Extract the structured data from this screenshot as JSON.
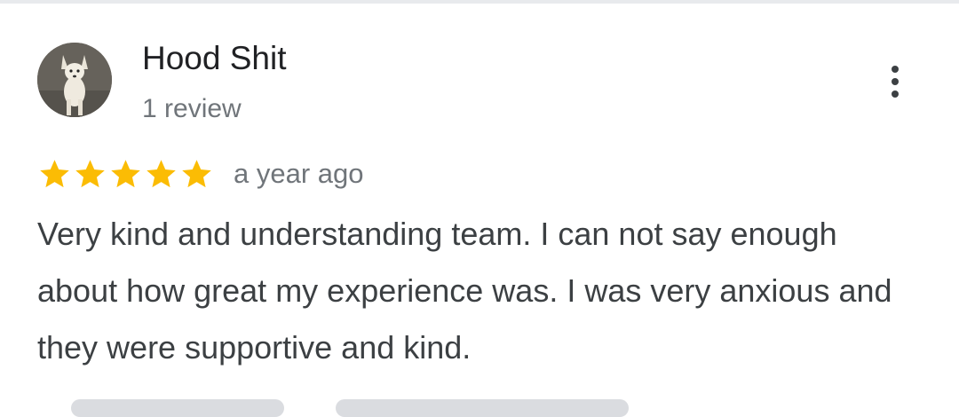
{
  "review": {
    "author": {
      "name": "Hood Shit",
      "review_count": "1 review",
      "avatar_icon": "dog-photo-avatar"
    },
    "rating": 5,
    "max_rating": 5,
    "date": "a year ago",
    "text": "Very kind and understanding team. I can not say enough about how great my experience was. I was very anxious and they were supportive and kind.",
    "menu_icon": "more-vert-icon"
  },
  "colors": {
    "star": "#fbbc04",
    "name": "#202124",
    "secondary": "#70757a",
    "body": "#3c4043",
    "divider": "#e8eaed"
  }
}
